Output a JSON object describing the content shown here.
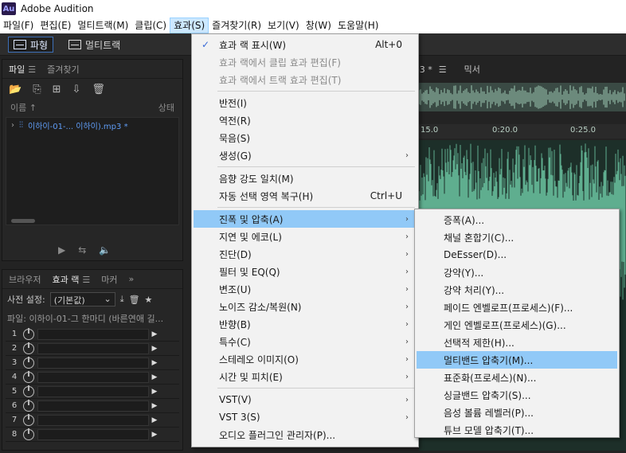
{
  "app": {
    "title": "Adobe Audition",
    "logo": "Au"
  },
  "menubar": [
    "파일(F)",
    "편집(E)",
    "멀티트랙(M)",
    "클립(C)",
    "효과(S)",
    "즐겨찾기(R)",
    "보기(V)",
    "창(W)",
    "도움말(H)"
  ],
  "toolbar": {
    "waveform": "파형",
    "multitrack": "멀티트랙"
  },
  "files_panel": {
    "tabs": [
      "파일",
      "즐겨찾기"
    ],
    "col_name": "이름 ↑",
    "col_status": "상태",
    "file_name": "이하이-01-... 이하이).mp3 *"
  },
  "effects_panel": {
    "tabs": [
      "브라우저",
      "효과 랙",
      "마커"
    ],
    "preset_label": "사전 설정:",
    "preset_value": "(기본값)",
    "file_label": "파일: 이하이-01-그 한마디 (바른연애 길...",
    "rack_slots": [
      "1",
      "2",
      "3",
      "4",
      "5",
      "6",
      "7",
      "8"
    ]
  },
  "editor": {
    "tab_name": "o3 *",
    "mixer_tab": "믹서",
    "ticks": [
      "15.0",
      "0:20.0",
      "0:25.0"
    ]
  },
  "effects_menu": {
    "items": [
      {
        "label": "효과 랙 표시(W)",
        "shortcut": "Alt+0",
        "checked": true
      },
      {
        "label": "효과 랙에서 클립 효과 편집(F)",
        "disabled": true
      },
      {
        "label": "효과 랙에서 트랙 효과 편집(T)",
        "disabled": true
      },
      {
        "label": "반전(I)"
      },
      {
        "label": "역전(R)"
      },
      {
        "label": "묵음(S)"
      },
      {
        "label": "생성(G)",
        "submenu": true
      },
      {
        "label": "음향 강도 일치(M)"
      },
      {
        "label": "자동 선택 영역 복구(H)",
        "shortcut": "Ctrl+U"
      },
      {
        "label": "진폭 및 압축(A)",
        "submenu": true,
        "highlighted": true
      },
      {
        "label": "지연 및 에코(L)",
        "submenu": true
      },
      {
        "label": "진단(D)",
        "submenu": true
      },
      {
        "label": "필터 및 EQ(Q)",
        "submenu": true
      },
      {
        "label": "변조(U)",
        "submenu": true
      },
      {
        "label": "노이즈 감소/복원(N)",
        "submenu": true
      },
      {
        "label": "반향(B)",
        "submenu": true
      },
      {
        "label": "특수(C)",
        "submenu": true
      },
      {
        "label": "스테레오 이미지(O)",
        "submenu": true
      },
      {
        "label": "시간 및 피치(E)",
        "submenu": true
      },
      {
        "label": "VST(V)",
        "submenu": true
      },
      {
        "label": "VST 3(S)",
        "submenu": true
      },
      {
        "label": "오디오 플러그인 관리자(P)..."
      }
    ]
  },
  "amplitude_submenu": {
    "items": [
      "증폭(A)...",
      "채널 혼합기(C)...",
      "DeEsser(D)...",
      "강약(Y)...",
      "강약 처리(Y)...",
      "페이드 엔벨로프(프로세스)(F)...",
      "게인 엔벨로프(프로세스)(G)...",
      "선택적 제한(H)...",
      "멀티밴드 압축기(M)...",
      "표준화(프로세스)(N)...",
      "싱글밴드 압축기(S)...",
      "음성 볼륨 레벨러(P)...",
      "튜브 모델 압축기(T)..."
    ],
    "highlighted_index": 8
  },
  "colors": {
    "accent": "#91c9f7",
    "file_blue": "#5f9cf5",
    "waveform": "#5fae8f"
  }
}
